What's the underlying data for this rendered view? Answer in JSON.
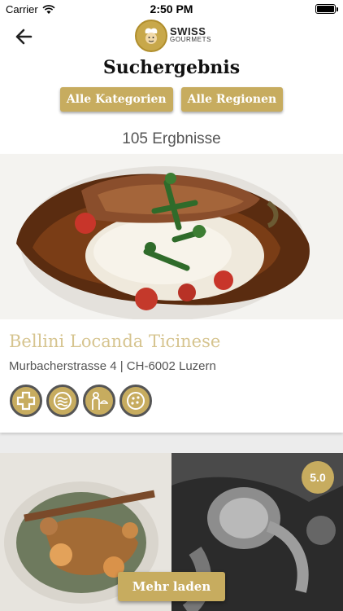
{
  "status_bar": {
    "carrier": "Carrier",
    "time": "2:50 PM"
  },
  "header": {
    "logo": {
      "word1": "SWISS",
      "word2": "GOURMETS"
    },
    "title": "Suchergebnis",
    "filters": [
      "Alle Kategorien",
      "Alle Regionen"
    ],
    "result_count": "105 Ergbnisse"
  },
  "results": [
    {
      "name": "Bellini Locanda Ticinese",
      "address": "Murbacherstrasse 4 | CH-6002 Luzern",
      "features": [
        "first-aid-icon",
        "ventilation-icon",
        "waiter-service-icon",
        "pizza-icon"
      ]
    },
    {
      "rating": "5.0"
    }
  ],
  "load_more": "Mehr laden",
  "colors": {
    "accent": "#c7ac5f",
    "title_gold": "#d6c48f"
  }
}
